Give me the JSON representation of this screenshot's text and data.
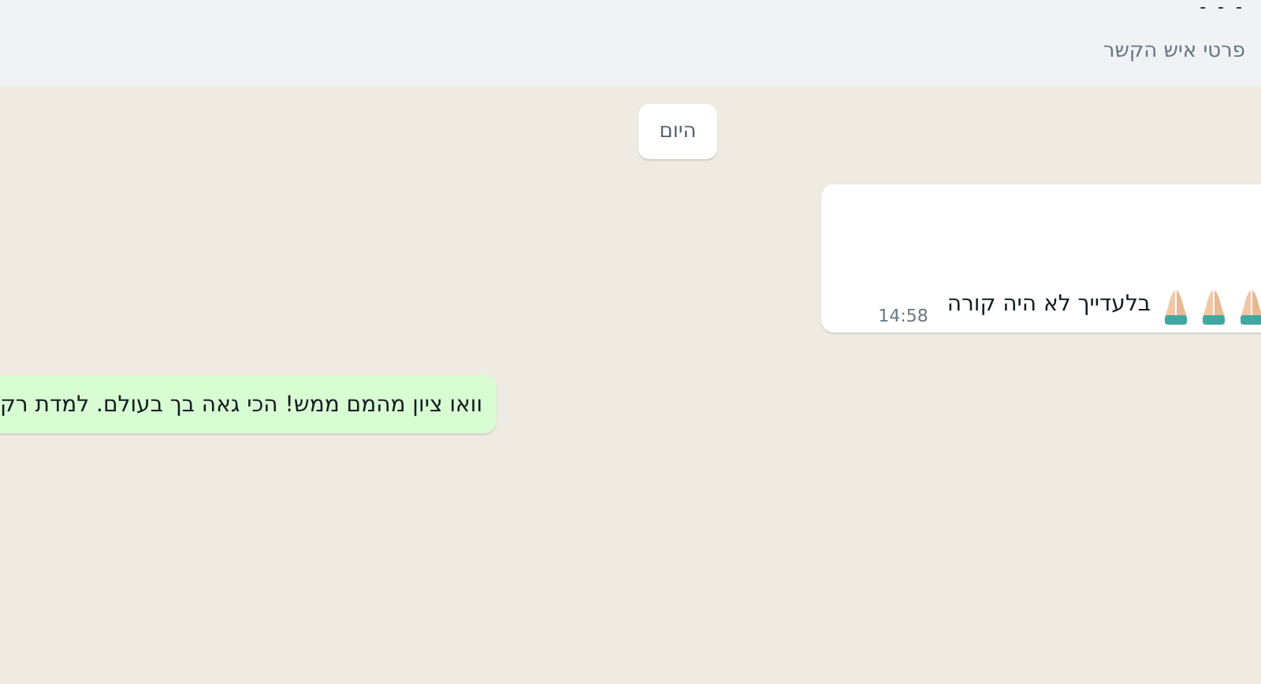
{
  "header": {
    "name": "- - -",
    "subtitle": "פרטי איש הקשר"
  },
  "date_divider": "היום",
  "messages": [
    {
      "kind": "incoming",
      "text": "בלעדייך לא היה קורה",
      "time": "14:58"
    },
    {
      "kind": "outgoing",
      "text": "וואו ציון מהמם ממש! הכי גאה בך בעולם. למדת רק"
    }
  ]
}
